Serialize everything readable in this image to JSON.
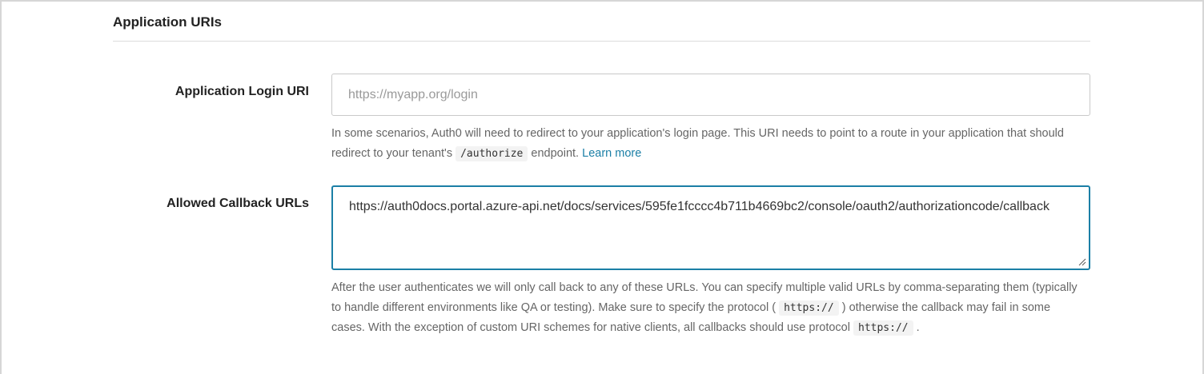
{
  "section": {
    "title": "Application URIs"
  },
  "login_uri": {
    "label": "Application Login URI",
    "placeholder": "https://myapp.org/login",
    "value": "",
    "help_before": "In some scenarios, Auth0 will need to redirect to your application's login page. This URI needs to point to a route in your application that should redirect to your tenant's ",
    "help_code": "/authorize",
    "help_after": " endpoint. ",
    "help_link": "Learn more"
  },
  "callback_urls": {
    "label": "Allowed Callback URLs",
    "value": "https://auth0docs.portal.azure-api.net/docs/services/595fe1fcccc4b711b4669bc2/console/oauth2/authorizationcode/callback",
    "help_part1": "After the user authenticates we will only call back to any of these URLs. You can specify multiple valid URLs by comma-separating them (typically to handle different environments like QA or testing). Make sure to specify the protocol ( ",
    "help_code1": "https://",
    "help_part2": " ) otherwise the callback may fail in some cases. With the exception of custom URI schemes for native clients, all callbacks should use protocol ",
    "help_code2": "https://",
    "help_part3": " ."
  },
  "colors": {
    "accent": "#1b7fa6",
    "label": "#222222",
    "help_text": "#666666",
    "border": "#c9c9c9"
  }
}
